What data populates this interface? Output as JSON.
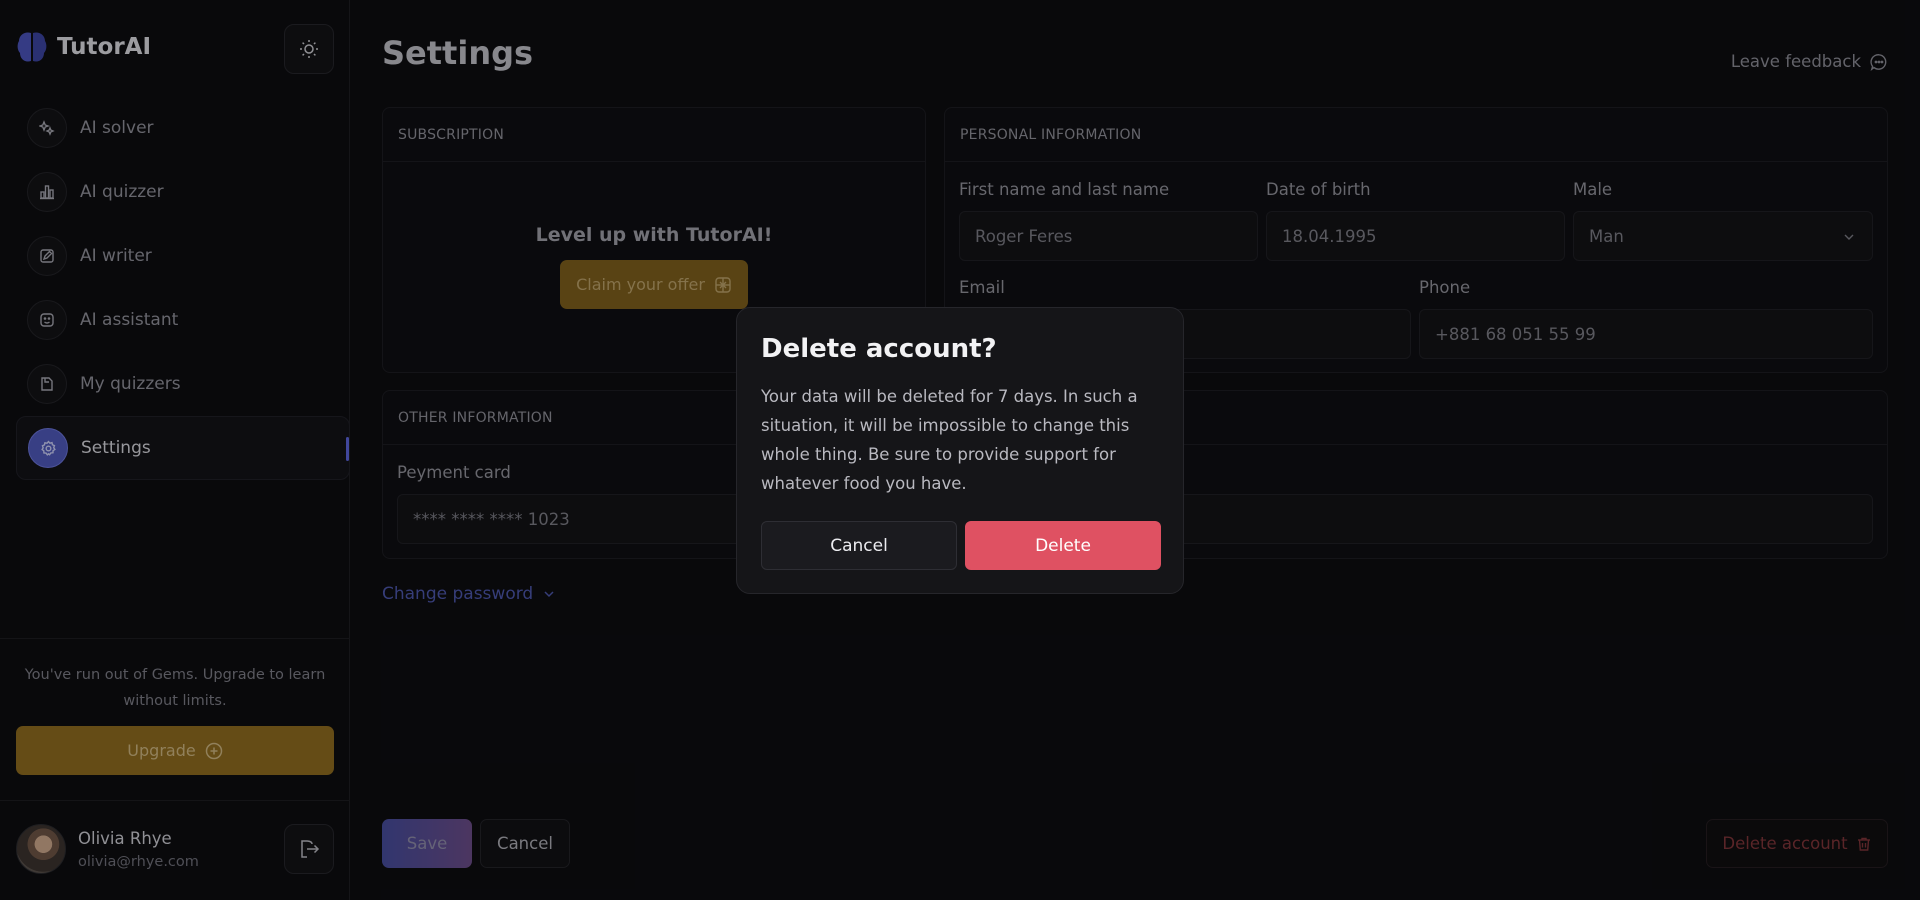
{
  "app": {
    "name": "TutorAI"
  },
  "sidebar": {
    "items": [
      {
        "label": "AI solver",
        "icon": "sparkles-icon"
      },
      {
        "label": "AI quizzer",
        "icon": "bar-chart-icon"
      },
      {
        "label": "AI writer",
        "icon": "edit-icon"
      },
      {
        "label": "AI assistant",
        "icon": "smile-icon"
      },
      {
        "label": "My quizzers",
        "icon": "document-icon"
      },
      {
        "label": "Settings",
        "icon": "gear-icon",
        "active": true
      }
    ],
    "gems_text": "You've run out of Gems. Upgrade to learn without limits.",
    "upgrade_label": "Upgrade",
    "user": {
      "name": "Olivia Rhye",
      "email": "olivia@rhye.com"
    }
  },
  "page": {
    "title": "Settings",
    "feedback_label": "Leave feedback"
  },
  "subscription": {
    "header": "SUBSCRIPTION",
    "headline": "Level up with TutorAI!",
    "claim_label": "Claim your offer"
  },
  "personal": {
    "header": "PERSONAL INFORMATION",
    "name_label": "First name and last name",
    "name_value": "Roger Feres",
    "dob_label": "Date of birth",
    "dob_value": "18.04.1995",
    "gender_label": "Male",
    "gender_value": "Man",
    "email_label": "Email",
    "phone_label": "Phone",
    "phone_value": "+881 68 051 55 99"
  },
  "other": {
    "header": "OTHER INFORMATION",
    "card_label": "Peyment card",
    "card_value": "**** **** **** 1023"
  },
  "actions": {
    "change_password": "Change password",
    "save": "Save",
    "cancel": "Cancel",
    "delete_account": "Delete account"
  },
  "modal": {
    "title": "Delete account?",
    "body": "Your data will be deleted for 7 days. In such a situation, it will be impossible to change this whole thing. Be sure to provide support for whatever food you have.",
    "cancel": "Cancel",
    "delete": "Delete"
  },
  "colors": {
    "accent": "#4e58b8",
    "upgrade": "#8c6a1f",
    "danger": "#df5162"
  }
}
